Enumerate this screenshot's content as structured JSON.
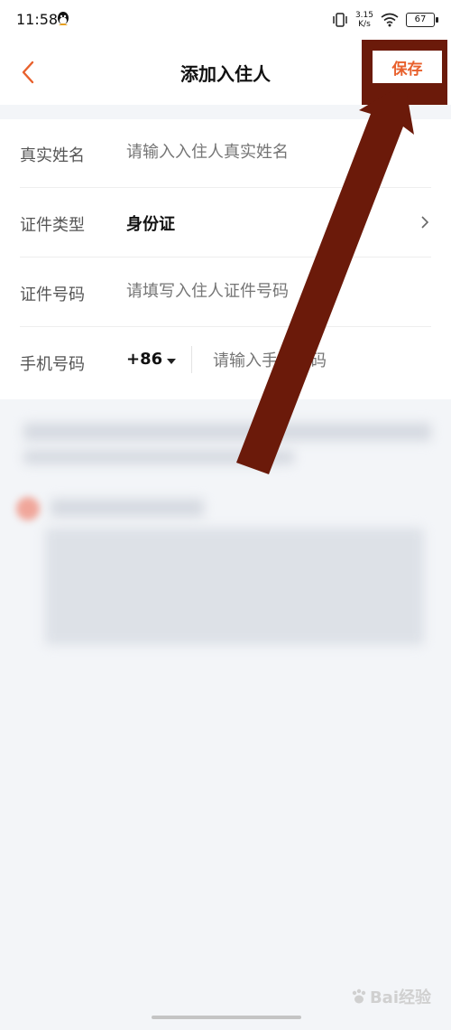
{
  "status_bar": {
    "time": "11:58",
    "net_speed_value": "3.15",
    "net_speed_unit": "K/s",
    "battery": "67"
  },
  "nav": {
    "title": "添加入住人",
    "save_label": "保存"
  },
  "form": {
    "name": {
      "label": "真实姓名",
      "placeholder": "请输入入住人真实姓名"
    },
    "id_type": {
      "label": "证件类型",
      "value": "身份证"
    },
    "id_number": {
      "label": "证件号码",
      "placeholder": "请填写入住人证件号码"
    },
    "phone": {
      "label": "手机号码",
      "country_code": "+86",
      "placeholder": "请输入手机号码"
    }
  },
  "watermark": {
    "text": "Bai经验"
  },
  "colors": {
    "accent": "#e8602c",
    "annotation": "#6b1a0a",
    "background": "#f3f5f8"
  }
}
